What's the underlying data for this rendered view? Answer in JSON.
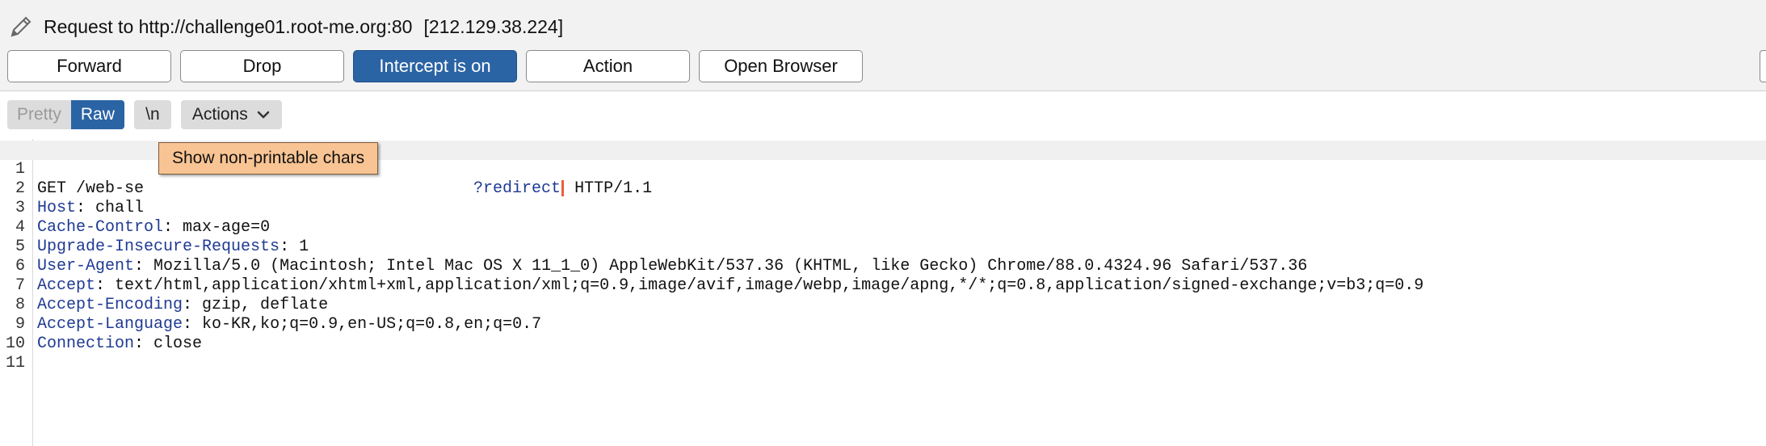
{
  "request": {
    "target": "Request to http://challenge01.root-me.org:80",
    "ip": "[212.129.38.224]"
  },
  "toolbar": {
    "forward": "Forward",
    "drop": "Drop",
    "intercept": "Intercept is on",
    "action": "Action",
    "open_browser": "Open Browser"
  },
  "view_modes": {
    "pretty": "Pretty",
    "raw": "Raw",
    "newline": "\\n",
    "actions": "Actions"
  },
  "tooltip": "Show non-printable chars",
  "editor": {
    "lines": [
      {
        "n": "1",
        "method_path_start": "GET /web-se",
        "query": "?redirect",
        "protocol": " HTTP/1.1"
      },
      {
        "n": "2",
        "name": "Host",
        "value": " chall"
      },
      {
        "n": "3",
        "name": "Cache-Control",
        "value": " max-age=0"
      },
      {
        "n": "4",
        "name": "Upgrade-Insecure-Requests",
        "value": " 1"
      },
      {
        "n": "5",
        "name": "User-Agent",
        "value": " Mozilla/5.0 (Macintosh; Intel Mac OS X 11_1_0) AppleWebKit/537.36 (KHTML, like Gecko) Chrome/88.0.4324.96 Safari/537.36"
      },
      {
        "n": "6",
        "name": "Accept",
        "value": " text/html,application/xhtml+xml,application/xml;q=0.9,image/avif,image/webp,image/apng,*/*;q=0.8,application/signed-exchange;v=b3;q=0.9"
      },
      {
        "n": "7",
        "name": "Accept-Encoding",
        "value": " gzip, deflate"
      },
      {
        "n": "8",
        "name": "Accept-Language",
        "value": " ko-KR,ko;q=0.9,en-US;q=0.8,en;q=0.7"
      },
      {
        "n": "9",
        "name": "Connection",
        "value": " close"
      },
      {
        "n": "10"
      },
      {
        "n": "11"
      }
    ],
    "colon": ":"
  }
}
